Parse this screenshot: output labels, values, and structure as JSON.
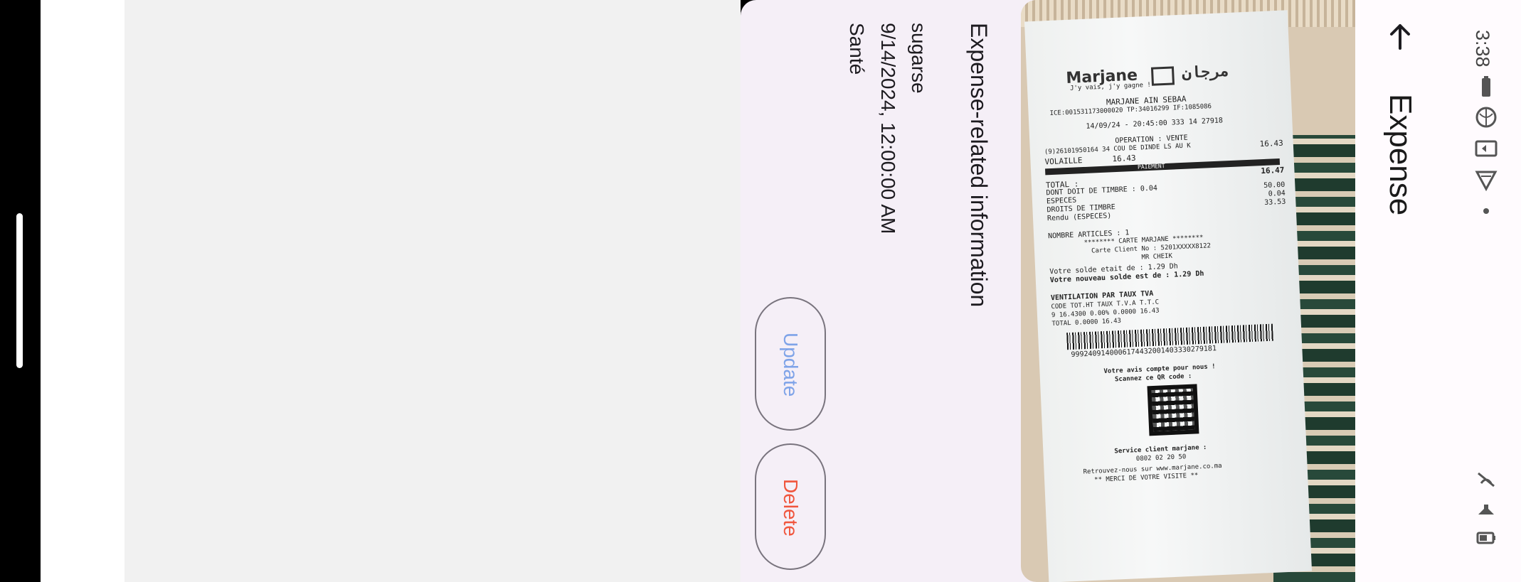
{
  "status_bar": {
    "time": "3:38",
    "icons": [
      "battery-icon",
      "globe-icon",
      "cast-icon",
      "wifi-icon",
      "notification-dot-icon",
      "vibrate-off-icon",
      "volume-icon",
      "battery-small-icon"
    ]
  },
  "header": {
    "back_icon": "arrow-back-icon",
    "title": "Expense"
  },
  "receipt": {
    "brand": "Marjane",
    "brand_arabic": "مرجان",
    "tagline": "J'y vais, j'y gagne !",
    "store": "MARJANE AIN SEBAA",
    "ids": "ICE:001531173000020   TP:34016299  IF:1085086",
    "datetime": "14/09/24 - 20:45:00 333 14 27918",
    "operation": "OPERATION : VENTE",
    "item_line": "(9)26101950164 34  COU DE DINDE LS AU K",
    "item_price": "16.43",
    "category_line": "VOLAILLE",
    "category_amount": "16.43",
    "band_label": "PAIEMENT",
    "total_label": "TOTAL :",
    "total_value": "16.47",
    "timbre": "DONT DOIT DE TIMBRE : 0.04",
    "especes_label": "ESPECES",
    "especes_value": "50.00",
    "droits_label": "DROITS DE TIMBRE",
    "droits_value": "0.04",
    "rendu_label": "Rendu (ESPECES)",
    "rendu_value": "33.53",
    "articles": "NOMBRE ARTICLES : 1",
    "carte": "******** CARTE MARJANE ********",
    "carte_client": "Carte Client No : 5201XXXXX8122",
    "client_name": "MR CHEIK",
    "solde_old": "Votre solde etait de : 1.29 Dh",
    "solde_new": "Votre nouveau solde est de : 1.29 Dh",
    "tva_title": "VENTILATION PAR TAUX TVA",
    "tva_header": "CODE   TOT.HT   TAUX    T.V.A    T.T.C",
    "tva_row": "9      16.4300  0.00%   0.0000   16.43",
    "tva_total": "TOTAL                  0.0000   16.43",
    "barcode_number": "9992409140006174432001403330279181",
    "avis": "Votre avis compte pour nous !",
    "scan": "Scannez ce QR code :",
    "service": "Service client marjane :",
    "phone": "0802 02 20 50",
    "website": "Retrouvez-nous sur www.marjane.co.ma",
    "merci": "** MERCI DE VOTRE VISITE **"
  },
  "expense": {
    "heading": "Expense-related information",
    "name": "sugarse",
    "date": "9/14/2024, 12:00:00 AM",
    "category": "Santé"
  },
  "actions": {
    "update_label": "Update",
    "delete_label": "Delete"
  },
  "colors": {
    "card_background": "#f5eff7",
    "update_text": "#7ea3e8",
    "delete_text": "#f0553d",
    "button_border": "#79747e"
  }
}
